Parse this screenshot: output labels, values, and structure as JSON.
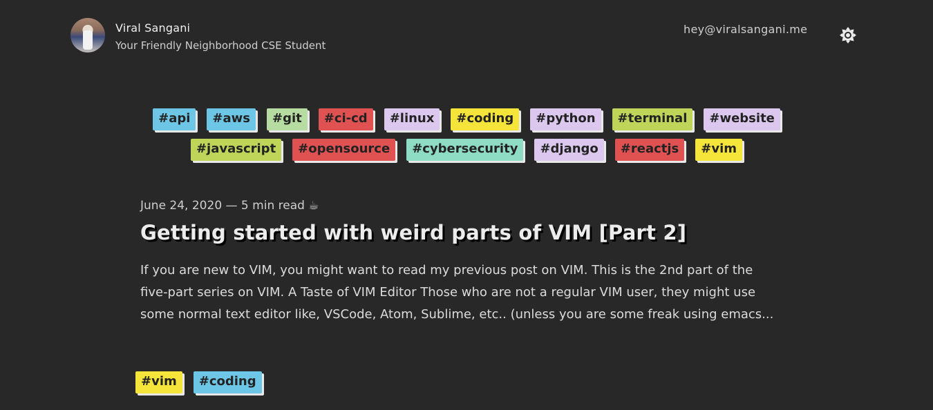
{
  "header": {
    "name": "Viral Sangani",
    "tagline": "Your Friendly Neighborhood CSE Student",
    "email": "hey@viralsangani.me",
    "theme_icon": "sun-icon"
  },
  "tag_cloud": [
    {
      "label": "#api",
      "color": "#6ec6e6"
    },
    {
      "label": "#aws",
      "color": "#6ec6e6"
    },
    {
      "label": "#git",
      "color": "#b6dca2"
    },
    {
      "label": "#ci-cd",
      "color": "#e05252"
    },
    {
      "label": "#linux",
      "color": "#dcc8ef"
    },
    {
      "label": "#coding",
      "color": "#f5e43a"
    },
    {
      "label": "#python",
      "color": "#dcc8ef"
    },
    {
      "label": "#terminal",
      "color": "#bfd55a"
    },
    {
      "label": "#website",
      "color": "#dcc8ef"
    },
    {
      "label": "#javascript",
      "color": "#bfd55a"
    },
    {
      "label": "#opensource",
      "color": "#e05252"
    },
    {
      "label": "#cybersecurity",
      "color": "#8fdcc4"
    },
    {
      "label": "#django",
      "color": "#dcc8ef"
    },
    {
      "label": "#reactjs",
      "color": "#e05252"
    },
    {
      "label": "#vim",
      "color": "#f5e43a"
    }
  ],
  "post": {
    "meta": "June 24, 2020 — 5 min read ☕",
    "title": "Getting started with weird parts of VIM [Part 2]",
    "excerpt": "If you are new to VIM, you might want to read my previous post on VIM. This is the 2nd part of the five-part series on VIM. A Taste of VIM Editor Those who are not a regular VIM user, they might use some normal text editor like, VSCode, Atom, Sublime, etc.. (unless you are some freak using emacs...",
    "tags": [
      {
        "label": "#vim",
        "color": "#f5e43a"
      },
      {
        "label": "#coding",
        "color": "#6ec6e6"
      }
    ]
  }
}
